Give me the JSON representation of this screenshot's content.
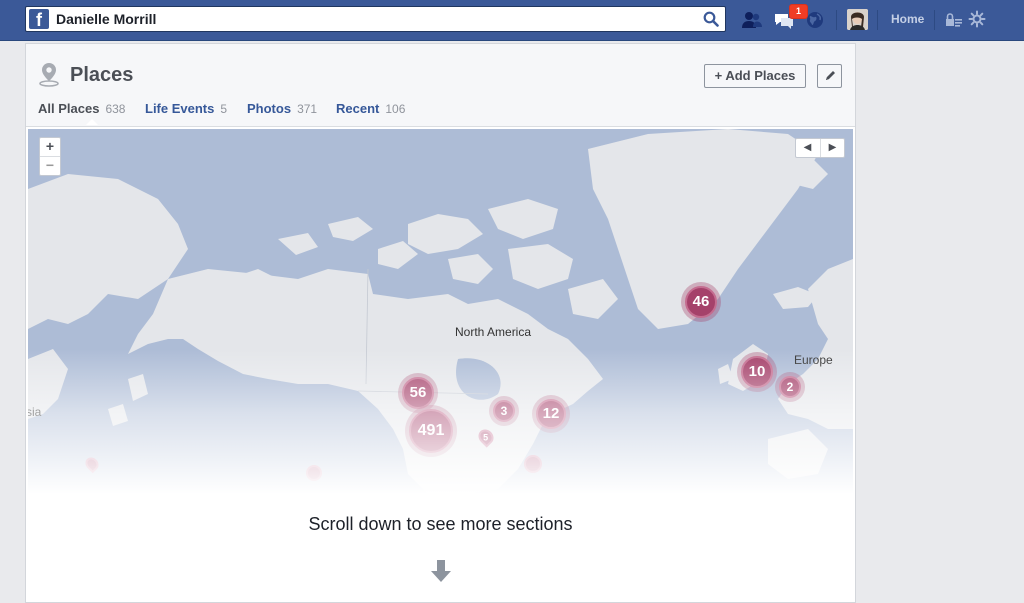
{
  "topbar": {
    "profile_name": "Danielle Morrill",
    "logo_glyph": "f",
    "notifications_count": "1",
    "home_label": "Home",
    "icons": [
      "search-icon",
      "friend-requests-icon",
      "messages-icon",
      "notifications-globe-icon",
      "privacy-shortcuts-icon",
      "settings-gear-icon"
    ],
    "brand_color": "#3b5998"
  },
  "page": {
    "title": "Places",
    "add_places_label": "+ Add Places",
    "tabs": [
      {
        "label": "All Places",
        "count": "638"
      },
      {
        "label": "Life Events",
        "count": "5"
      },
      {
        "label": "Photos",
        "count": "371"
      },
      {
        "label": "Recent",
        "count": "106"
      }
    ]
  },
  "map": {
    "zoom_in": "+",
    "zoom_out": "−",
    "prev": "◀",
    "next": "▶",
    "labels": {
      "north_america": "North America",
      "europe": "Europe",
      "asia": "sia"
    },
    "clusters": [
      "46",
      "56",
      "491",
      "3",
      "12",
      "10",
      "2",
      "5"
    ],
    "cluster_color": "#a5416a"
  },
  "footer": {
    "scroll_hint": "Scroll down to see more sections"
  }
}
